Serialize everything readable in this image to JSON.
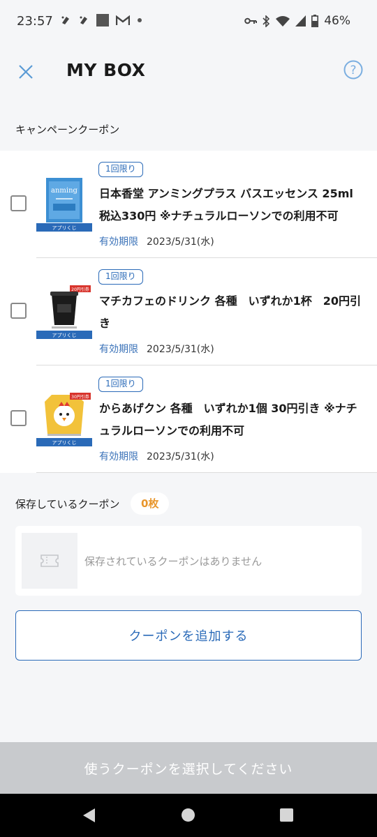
{
  "status_bar": {
    "time": "23:57",
    "battery": "46%",
    "left_icons": [
      "notification-icon",
      "notification-icon",
      "square-icon",
      "gmail-icon",
      "dot-icon"
    ],
    "right_icons": [
      "vpn-key-icon",
      "bluetooth-icon",
      "wifi-icon",
      "signal-icon",
      "battery-icon"
    ]
  },
  "header": {
    "title": "MY BOX",
    "close_icon": "close-icon",
    "help_icon": "help-icon"
  },
  "campaign": {
    "section_title": "キャンペーンクーポン",
    "coupons": [
      {
        "badge": "1回限り",
        "name": "日本香堂 アンミングプラス バスエッセンス 25ml 税込330円 ※ナチュラルローソンでの利用不可",
        "expiry_label": "有効期限",
        "expiry_date": "2023/5/31(水)",
        "thumb_caption": "アプリくじ",
        "thumb_brand": "anming",
        "checked": false
      },
      {
        "badge": "1回限り",
        "name": "マチカフェのドリンク 各種　いずれか1杯　20円引き",
        "expiry_label": "有効期限",
        "expiry_date": "2023/5/31(水)",
        "thumb_caption": "アプリくじ",
        "thumb_tag": "20円引券",
        "checked": false
      },
      {
        "badge": "1回限り",
        "name": "からあげクン 各種　いずれか1個 30円引き ※ナチュラルローソンでの利用不可",
        "expiry_label": "有効期限",
        "expiry_date": "2023/5/31(水)",
        "thumb_caption": "アプリくじ",
        "thumb_tag": "30円引券",
        "checked": false
      }
    ]
  },
  "saved": {
    "section_title": "保存しているクーポン",
    "count": "0枚",
    "empty_message": "保存されているクーポンはありません",
    "empty_icon": "ticket-icon"
  },
  "buttons": {
    "add_coupon": "クーポンを追加する",
    "use_coupon": "使うクーポンを選択してください"
  },
  "nav": {
    "back": "back-icon",
    "home": "home-icon",
    "recent": "recent-apps-icon"
  },
  "colors": {
    "accent": "#2a6ab8",
    "count": "#e8962c",
    "disabled_button": "#c8cacd"
  }
}
